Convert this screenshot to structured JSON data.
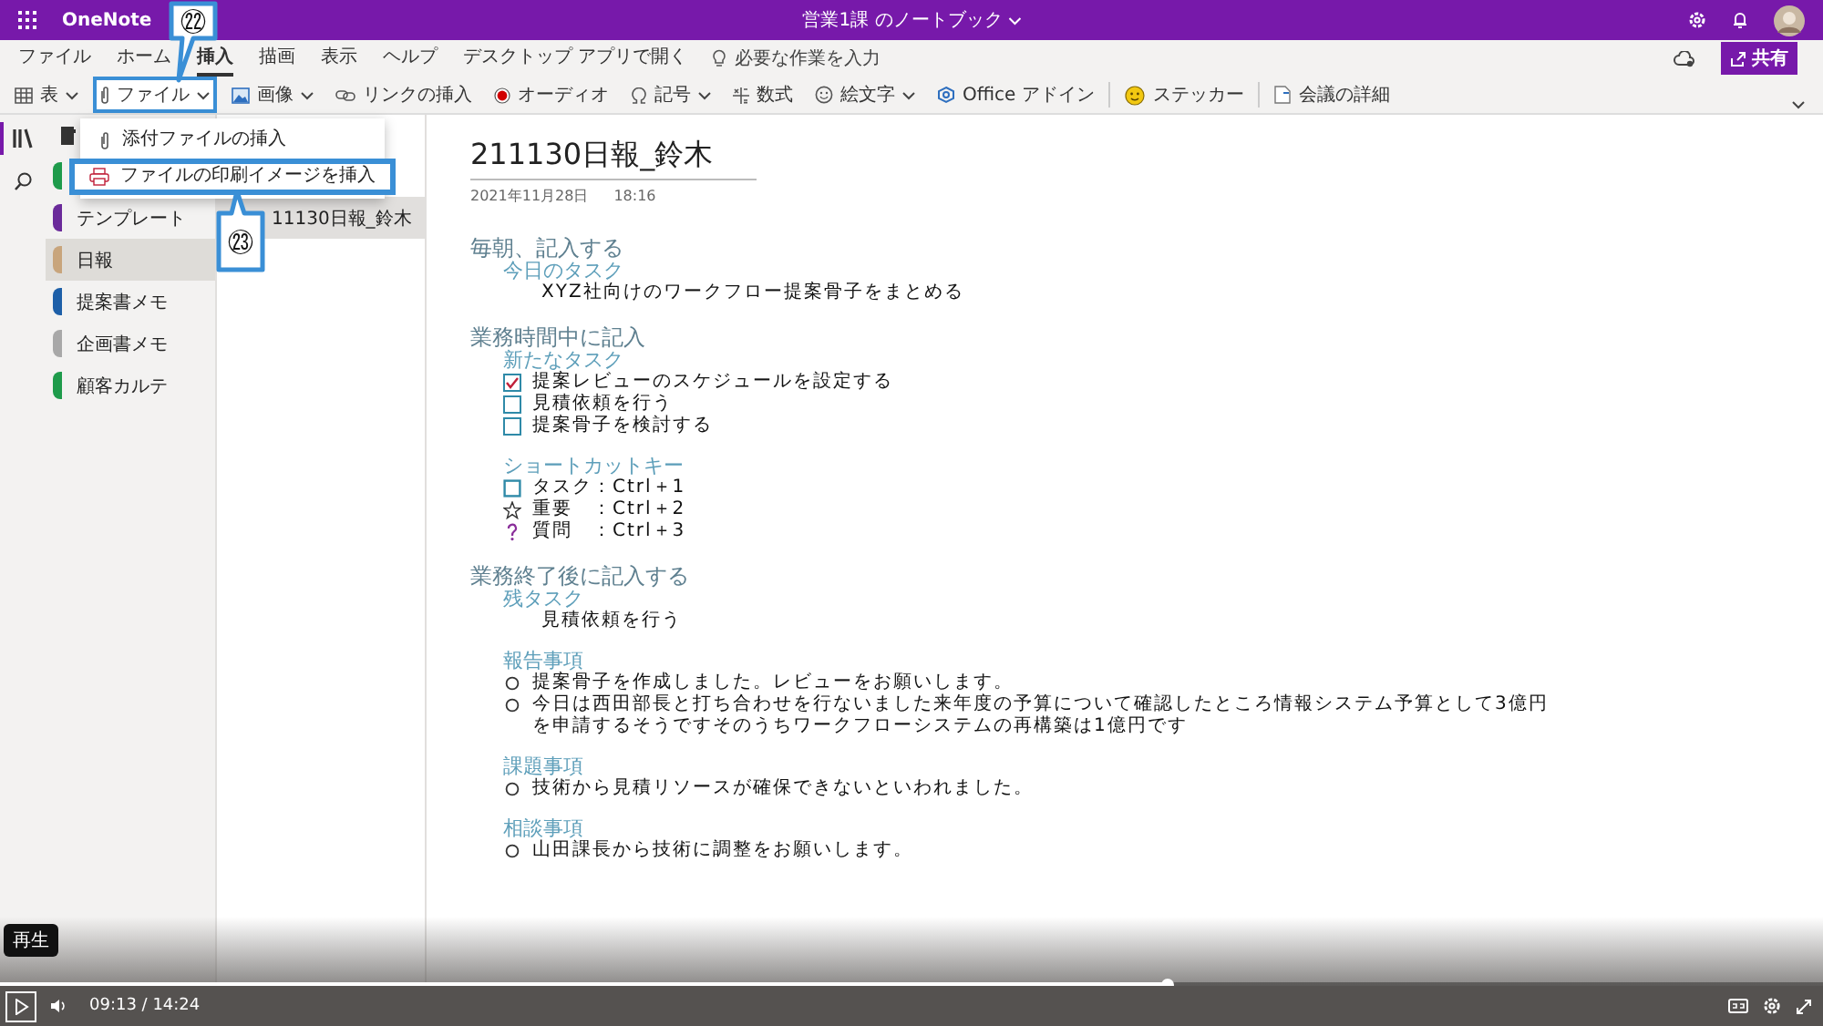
{
  "app_bar": {
    "app_name": "OneNote",
    "notebook_title": "営業1課 のノートブック"
  },
  "menu_tabs": [
    {
      "label": "ファイル",
      "selected": false
    },
    {
      "label": "ホーム",
      "selected": false
    },
    {
      "label": "挿入",
      "selected": true
    },
    {
      "label": "描画",
      "selected": false
    },
    {
      "label": "表示",
      "selected": false
    },
    {
      "label": "ヘルプ",
      "selected": false
    }
  ],
  "open_desktop": "デスクトップ アプリで開く",
  "tell_me": {
    "placeholder": "必要な作業を入力"
  },
  "share_button": "共有",
  "toolbar": [
    {
      "kind": "table",
      "label": "表",
      "dropdown": true,
      "highlighted": false,
      "separator_before": false
    },
    {
      "kind": "file",
      "label": "ファイル",
      "dropdown": true,
      "highlighted": true,
      "separator_before": false
    },
    {
      "kind": "image",
      "label": "画像",
      "dropdown": true,
      "highlighted": false,
      "separator_before": false
    },
    {
      "kind": "link",
      "label": "リンクの挿入",
      "dropdown": false,
      "highlighted": false,
      "separator_before": false
    },
    {
      "kind": "audio",
      "label": "オーディオ",
      "dropdown": false,
      "highlighted": false,
      "separator_before": false
    },
    {
      "kind": "symbol",
      "label": "記号",
      "dropdown": true,
      "highlighted": false,
      "separator_before": false
    },
    {
      "kind": "equation",
      "label": "数式",
      "dropdown": false,
      "highlighted": false,
      "separator_before": false
    },
    {
      "kind": "emoji",
      "label": "絵文字",
      "dropdown": true,
      "highlighted": false,
      "separator_before": false
    },
    {
      "kind": "addin",
      "label": "Office アドイン",
      "dropdown": false,
      "highlighted": false,
      "separator_before": false
    },
    {
      "kind": "sticker",
      "label": "ステッカー",
      "dropdown": false,
      "highlighted": false,
      "separator_before": true
    },
    {
      "kind": "meeting",
      "label": "会議の詳細",
      "dropdown": false,
      "highlighted": false,
      "separator_before": true
    }
  ],
  "insert_menu": [
    {
      "kind": "attach",
      "label": "添付ファイルの挿入",
      "highlighted": false
    },
    {
      "kind": "printout",
      "label": "ファイルの印刷イメージを挿入",
      "highlighted": true
    }
  ],
  "callouts": [
    "㉒",
    "㉓"
  ],
  "sections": [
    {
      "color": "#1e9b4b",
      "selected": false
    },
    {
      "label": "テンプレート",
      "color": "#6a2a9a",
      "selected": false
    },
    {
      "label": "日報",
      "color": "#c8a57c",
      "selected": true
    },
    {
      "label": "提案書メモ",
      "color": "#1d5fa8",
      "selected": false
    },
    {
      "label": "企画書メモ",
      "color": "#a8a8a8",
      "selected": false
    },
    {
      "label": "顧客カルテ",
      "color": "#1e9b4b",
      "selected": false
    }
  ],
  "pages": [
    {
      "title": "11130日報_鈴木",
      "selected": true
    }
  ],
  "note": {
    "title": "211130日報_鈴木",
    "date": "2021年11月28日",
    "time": "18:16",
    "outline": [
      {
        "heading": "毎朝、記入する",
        "groups": [
          {
            "subheading": "今日のタスク",
            "items": [
              {
                "kind": "text",
                "text": "XYZ社向けのワークフロー提案骨子をまとめる"
              }
            ]
          }
        ]
      },
      {
        "heading": "業務時間中に記入",
        "groups": [
          {
            "subheading": "新たなタスク",
            "items": [
              {
                "kind": "todo",
                "checked": true,
                "text": "提案レビューのスケジュールを設定する"
              },
              {
                "kind": "todo",
                "checked": false,
                "text": "見積依頼を行う"
              },
              {
                "kind": "todo",
                "checked": false,
                "text": "提案骨子を検討する"
              }
            ]
          },
          {
            "subheading": "ショートカットキー",
            "items": [
              {
                "kind": "square",
                "text": "タスク：Ctrl＋1"
              },
              {
                "kind": "star",
                "text": "重要　：Ctrl＋2"
              },
              {
                "kind": "question",
                "text": "質問　：Ctrl＋3"
              }
            ]
          }
        ]
      },
      {
        "heading": "業務終了後に記入する",
        "groups": [
          {
            "subheading": "残タスク",
            "items": [
              {
                "kind": "text",
                "text": "見積依頼を行う"
              }
            ]
          },
          {
            "subheading": "報告事項",
            "items": [
              {
                "kind": "bullet",
                "text": "提案骨子を作成しました。レビューをお願いします。"
              },
              {
                "kind": "bullet",
                "text": "今日は西田部長と打ち合わせを行ないました来年度の予算について確認したところ情報システム予算として3億円を申請するそうですそのうちワークフローシステムの再構築は1億円です"
              }
            ]
          },
          {
            "subheading": "課題事項",
            "items": [
              {
                "kind": "bullet",
                "text": "技術から見積リソースが確保できないといわれました。"
              }
            ]
          },
          {
            "subheading": "相談事項",
            "items": [
              {
                "kind": "bullet",
                "text": "山田課長から技術に調整をお願いします。"
              }
            ]
          }
        ]
      }
    ]
  },
  "player": {
    "tooltip": "再生",
    "time": "09:13 / 14:24",
    "level": 0.64
  }
}
